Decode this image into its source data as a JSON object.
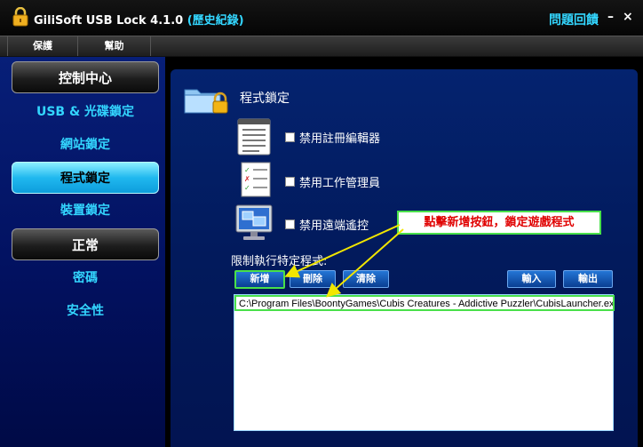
{
  "titlebar": {
    "app_name": "GiliSoft USB Lock 4.1.0",
    "edition": "(歷史紀錄)",
    "feedback": "問題回饋",
    "minimize": "–",
    "close": "×"
  },
  "menu": [
    "保護",
    "幫助"
  ],
  "sidebar": {
    "section1": "控制中心",
    "items1": [
      "USB & 光碟鎖定",
      "網站鎖定",
      "程式鎖定",
      "裝置鎖定"
    ],
    "active_index": 2,
    "section2": "正常",
    "items2": [
      "密碼",
      "安全性"
    ]
  },
  "main": {
    "title": "程式鎖定",
    "options": [
      "禁用註冊編輯器",
      "禁用工作管理員",
      "禁用遠端遙控"
    ],
    "restrict_label": "限制執行特定程式:",
    "buttons": {
      "add": "新增",
      "delete": "刪除",
      "clear": "清除",
      "import": "輸入",
      "export": "輸出"
    },
    "list": [
      "C:\\Program Files\\BoontyGames\\Cubis Creatures - Addictive Puzzler\\CubisLauncher.exe"
    ]
  },
  "annotation": {
    "text": "點擊新增按鈕，鎖定遊戲程式"
  },
  "colors": {
    "accent_cyan": "#33d6ff",
    "panel_blue": "#021a5c",
    "highlight_green": "#49e04a",
    "annotation_red": "#e00000"
  },
  "icons": [
    "lock-icon",
    "folder-lock-icon",
    "registry-icon",
    "task-list-icon",
    "remote-screen-icon"
  ]
}
